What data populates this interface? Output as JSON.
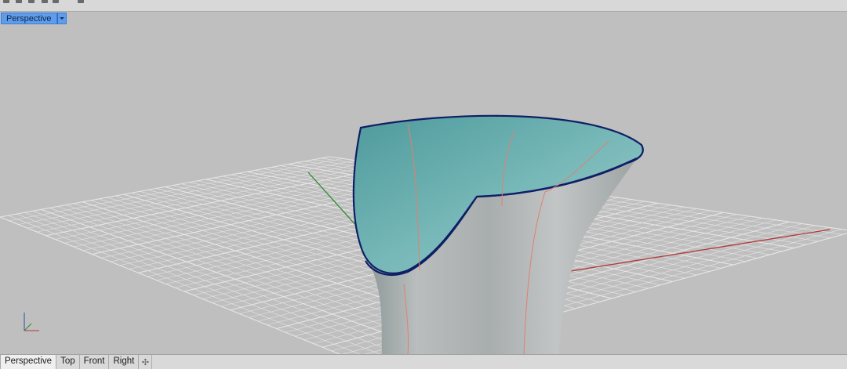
{
  "viewport": {
    "title": "Perspective",
    "menu_icon": "chevron-down-icon"
  },
  "tabs": [
    {
      "label": "Perspective",
      "active": true
    },
    {
      "label": "Top",
      "active": false
    },
    {
      "label": "Front",
      "active": false
    },
    {
      "label": "Right",
      "active": false
    }
  ],
  "add_tab_icon": "plus-icon",
  "colors": {
    "background": "#bfbfbf",
    "grid": "#e6e6e6",
    "x_axis": "#b23a3a",
    "y_axis": "#2f8a2f",
    "surface_inner": "#6fb4b4",
    "surface_outer": "#b7bcbc",
    "edge": "#0f1f66",
    "isocurve": "#e08070"
  }
}
